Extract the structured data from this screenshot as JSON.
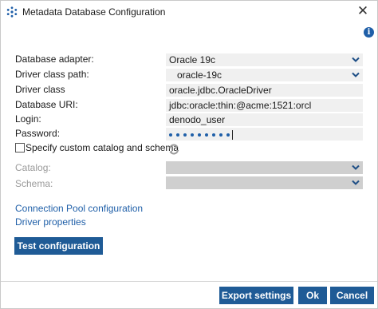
{
  "window": {
    "title": "Metadata Database Configuration",
    "close_symbol": "✕"
  },
  "icons": {
    "app": "cluster-logo-icon",
    "info": "info-icon",
    "chevron": "chevron-down-icon",
    "refresh": "refresh-icon"
  },
  "form": {
    "adapter": {
      "label": "Database adapter:",
      "value": "Oracle 19c"
    },
    "classpath": {
      "label": "Driver class path:",
      "value": "oracle-19c"
    },
    "driver_class": {
      "label": "Driver class",
      "value": "oracle.jdbc.OracleDriver"
    },
    "uri": {
      "label": "Database URI:",
      "value": "jdbc:oracle:thin:@acme:1521:orcl"
    },
    "login": {
      "label": "Login:",
      "value": "denodo_user"
    },
    "password": {
      "label": "Password:",
      "mask_count": 9
    },
    "custom_catalog": {
      "label": "Specify custom catalog and schema",
      "checked": false
    },
    "catalog": {
      "label": "Catalog:",
      "value": ""
    },
    "schema": {
      "label": "Schema:",
      "value": ""
    }
  },
  "links": {
    "pool": "Connection Pool configuration",
    "driver_props": "Driver properties"
  },
  "buttons": {
    "test": "Test configuration",
    "export": "Export settings",
    "ok": "Ok",
    "cancel": "Cancel"
  },
  "colors": {
    "accent": "#1f5b96",
    "link": "#1f5fa8",
    "field_bg": "#f0f0f0",
    "disabled_field_bg": "#cfcfcf"
  }
}
